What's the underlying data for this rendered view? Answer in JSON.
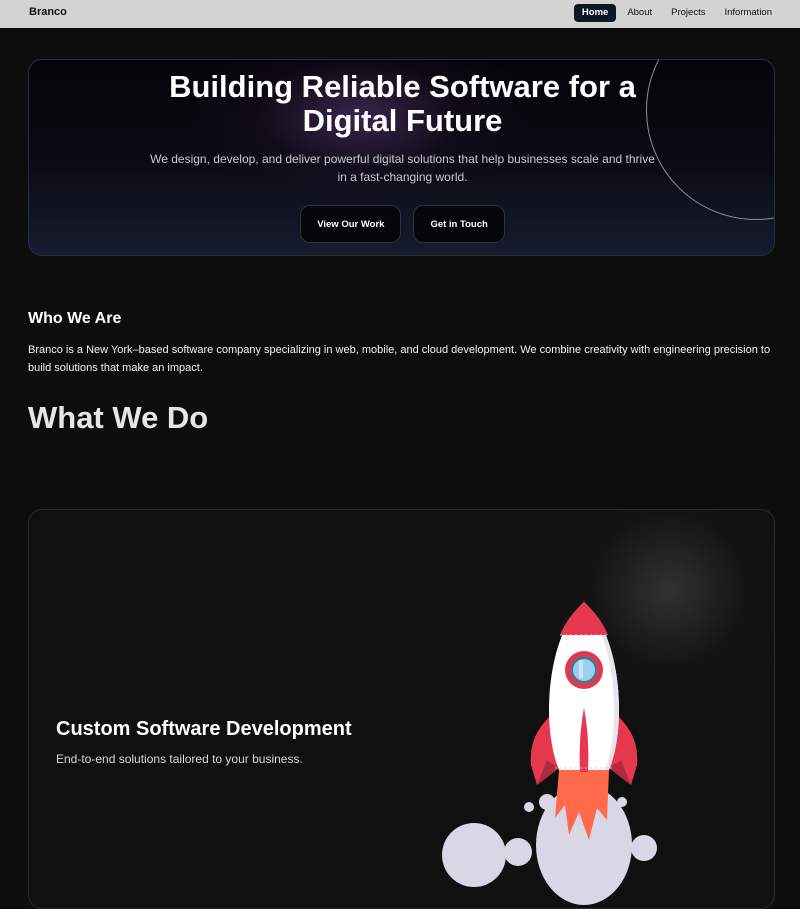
{
  "nav": {
    "brand": "Branco",
    "links": [
      "Home",
      "About",
      "Projects",
      "Information"
    ]
  },
  "hero": {
    "title": "Building Reliable Software for a Digital Future",
    "subtitle": "We design, develop, and deliver powerful digital solutions that help businesses scale and thrive in a fast-changing world.",
    "buttons": [
      "View Our Work",
      "Get in Touch"
    ]
  },
  "who": {
    "title": "Who We Are",
    "text": "Branco is a New York–based software company specializing in web, mobile, and cloud development. We combine creativity with engineering precision to build solutions that make an impact."
  },
  "what": {
    "title": "What We Do"
  },
  "services": [
    {
      "title": "Custom Software Development",
      "description": "End-to-end solutions tailored to your business.",
      "icon": "rocket-icon"
    }
  ],
  "colors": {
    "background": "#0d0d0d",
    "nav_bar": "#d3d3d3",
    "nav_active": "#0f1623",
    "rocket_red": "#e5384f",
    "rocket_flame": "#ff6b4a",
    "smoke": "#d9d6e6"
  }
}
